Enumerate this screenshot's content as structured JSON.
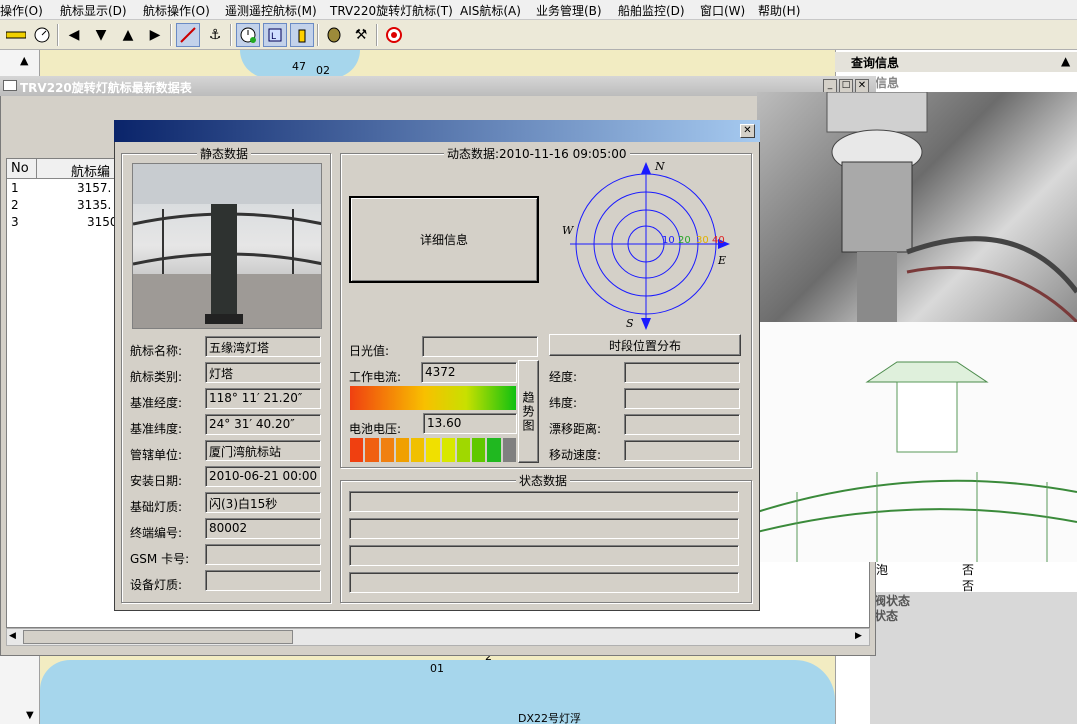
{
  "menu": [
    "操作(O)",
    "航标显示(D)",
    "航标操作(O)",
    "遥测遥控航标(M)",
    "TRV220旋转灯航标(T)",
    "AIS航标(A)",
    "业务管理(B)",
    "船舶监控(D)",
    "窗口(W)",
    "帮助(H)"
  ],
  "map": {
    "labels": [
      "47",
      "02",
      "01",
      "2",
      "DX22号灯浮"
    ]
  },
  "right_panel": {
    "title": "查询信息",
    "sub_title": "信息",
    "rows": [
      {
        "k": "泡",
        "v": "否"
      },
      {
        "k": "",
        "v": "否"
      }
    ],
    "sections": [
      "阀状态",
      "状态"
    ]
  },
  "table_window": {
    "title": "TRV220旋转灯航标最新数据表",
    "headers": [
      "No",
      "航标编"
    ],
    "rows": [
      {
        "no": "1",
        "code": "3157."
      },
      {
        "no": "2",
        "code": "3135."
      },
      {
        "no": "3",
        "code": "3150"
      }
    ]
  },
  "dialog": {
    "static": {
      "legend": "静态数据",
      "fields": [
        {
          "label": "航标名称:",
          "value": "五缘湾灯塔"
        },
        {
          "label": "航标类别:",
          "value": "灯塔"
        },
        {
          "label": "基准经度:",
          "value": "118° 11′ 21.20″"
        },
        {
          "label": "基准纬度:",
          "value": "24° 31′ 40.20″"
        },
        {
          "label": "管辖单位:",
          "value": "厦门湾航标站"
        },
        {
          "label": "安装日期:",
          "value": "2010-06-21 00:00"
        },
        {
          "label": "基础灯质:",
          "value": "闪(3)白15秒"
        },
        {
          "label": "终端编号:",
          "value": "80002"
        },
        {
          "label": "GSM 卡号:",
          "value": ""
        },
        {
          "label": "设备灯质:",
          "value": ""
        }
      ]
    },
    "dynamic": {
      "legend_prefix": "动态数据:",
      "datetime": "2010-11-16 09:05:00",
      "detail_button": "详细信息",
      "period_button": "时段位置分布",
      "sunlight_label": "日光值:",
      "sunlight_value": "",
      "current_label": "工作电流:",
      "current_value": "4372",
      "voltage_label": "电池电压:",
      "voltage_value": "13.60",
      "trend_button": "趋势图",
      "right_fields": [
        {
          "label": "经度:",
          "value": ""
        },
        {
          "label": "纬度:",
          "value": ""
        },
        {
          "label": "漂移距离:",
          "value": ""
        },
        {
          "label": "移动速度:",
          "value": ""
        }
      ],
      "compass": {
        "n": "N",
        "s": "S",
        "e": "E",
        "w": "W",
        "rings": [
          "10",
          "20",
          "30",
          "40"
        ]
      }
    },
    "status": {
      "legend": "状态数据",
      "rows": 4
    }
  }
}
